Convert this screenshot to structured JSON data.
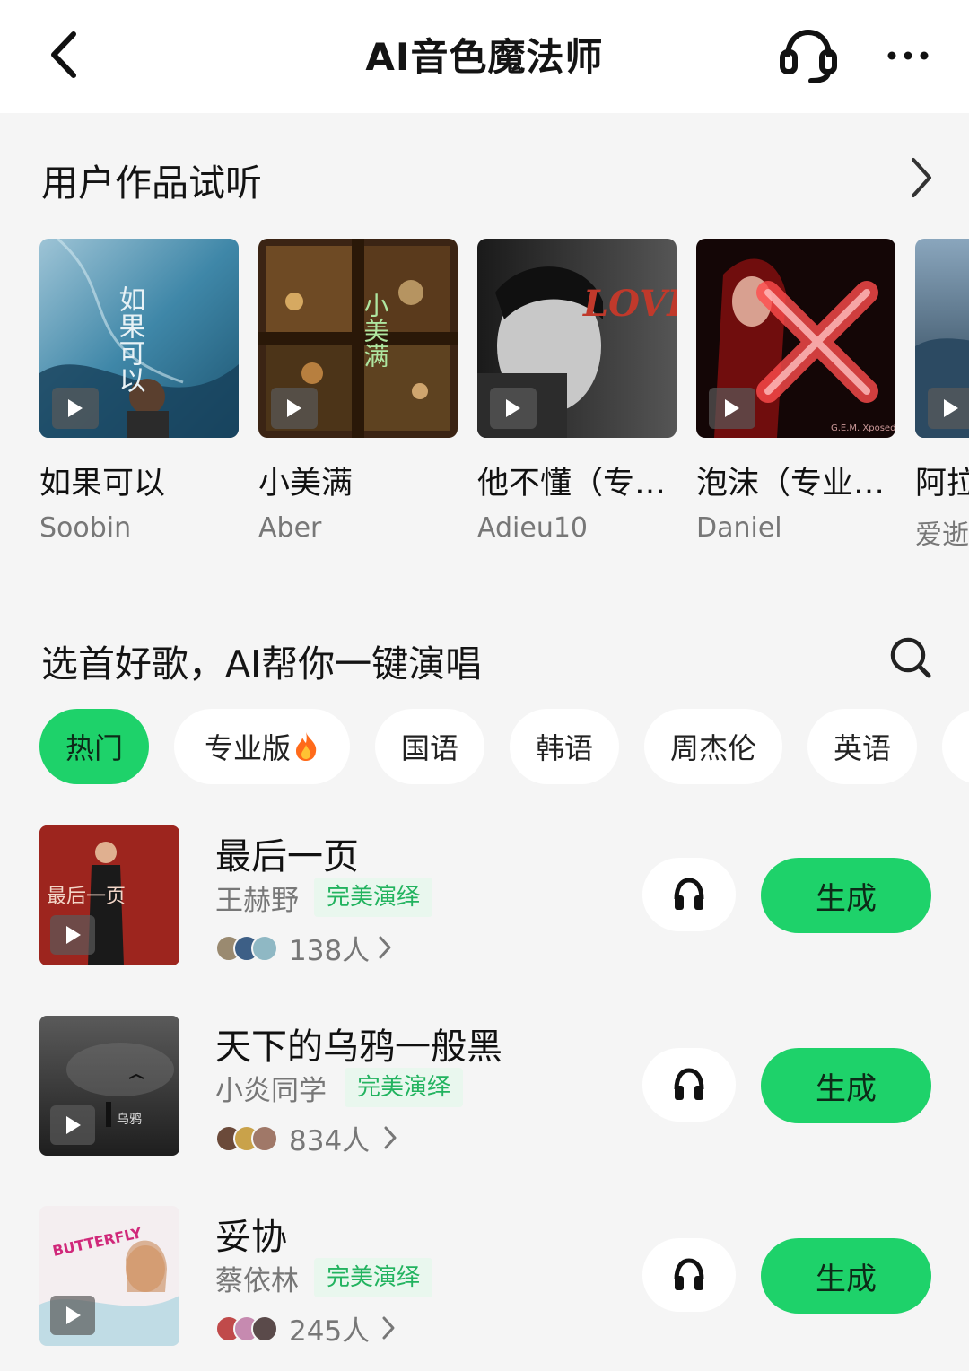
{
  "header": {
    "title": "AI音色魔法师",
    "back_icon": "chevron-left-icon",
    "support_icon": "headset-icon",
    "more_icon": "more-horizontal-icon"
  },
  "user_works": {
    "title": "用户作品试听",
    "items": [
      {
        "title": "如果可以",
        "artist": "Soobin",
        "cover_text": "如果可以"
      },
      {
        "title": "小美满",
        "artist": "Aber",
        "cover_text": "小美满"
      },
      {
        "title": "他不懂（专…",
        "artist": "Adieu10",
        "cover_text": "LOVE"
      },
      {
        "title": "泡沫（专业…",
        "artist": "Daniel",
        "cover_text": "G.E.M. Xposed"
      },
      {
        "title": "阿拉",
        "artist": "爱逝",
        "cover_text": ""
      }
    ]
  },
  "song_picker": {
    "title": "选首好歌，AI帮你一键演唱",
    "search_icon": "search-icon",
    "tabs": [
      "热门",
      "专业版",
      "国语",
      "韩语",
      "周杰伦",
      "英语"
    ],
    "active_tab": "热门",
    "songs": [
      {
        "title": "最后一页",
        "artist": "王赫野",
        "badge": "完美演绎",
        "count": "138人",
        "action": "生成",
        "cover_text": "最后一页"
      },
      {
        "title": "天下的乌鸦一般黑",
        "artist": "小炎同学",
        "badge": "完美演绎",
        "count": "834人",
        "action": "生成",
        "cover_text": "乌鸦"
      },
      {
        "title": "妥协",
        "artist": "蔡依林",
        "badge": "完美演绎",
        "count": "245人",
        "action": "生成",
        "cover_text": "BUTTERFLY"
      }
    ]
  },
  "colors": {
    "accent": "#1ed26a",
    "badge_text": "#22b35f",
    "badge_bg": "#e9f7ee"
  }
}
